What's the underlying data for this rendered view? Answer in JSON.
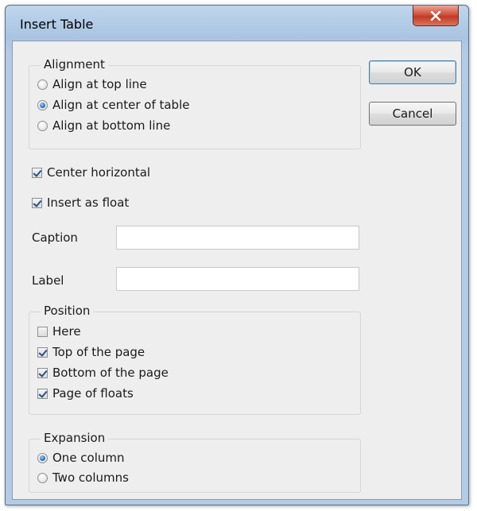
{
  "window": {
    "title": "Insert Table"
  },
  "buttons": {
    "ok": "OK",
    "cancel": "Cancel"
  },
  "alignment": {
    "title": "Alignment",
    "options": [
      {
        "label": "Align at top line",
        "checked": false
      },
      {
        "label": "Align at center of table",
        "checked": true
      },
      {
        "label": "Align at bottom line",
        "checked": false
      }
    ]
  },
  "center_horizontal": {
    "label": "Center horizontal",
    "checked": true
  },
  "insert_as_float": {
    "label": "Insert as float",
    "checked": true
  },
  "caption": {
    "label": "Caption",
    "value": ""
  },
  "label_field": {
    "label": "Label",
    "value": ""
  },
  "position": {
    "title": "Position",
    "options": [
      {
        "label": "Here",
        "checked": false
      },
      {
        "label": "Top of the page",
        "checked": true
      },
      {
        "label": "Bottom of the page",
        "checked": true
      },
      {
        "label": "Page of floats",
        "checked": true
      }
    ]
  },
  "expansion": {
    "title": "Expansion",
    "options": [
      {
        "label": "One column",
        "checked": true
      },
      {
        "label": "Two columns",
        "checked": false
      }
    ]
  },
  "icons": {
    "close": "close-x-icon"
  }
}
